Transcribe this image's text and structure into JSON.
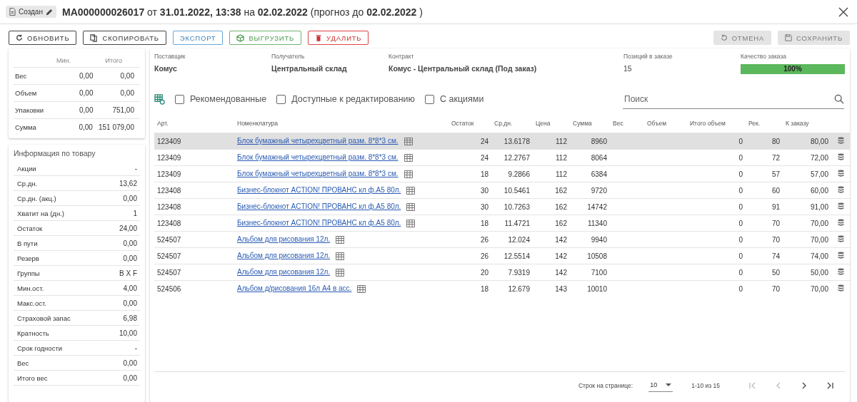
{
  "header": {
    "status": "Создан",
    "title": "**MA000000026017** от **31.01.2022, 13:38** на **02.02.2022** (прогноз до **02.02.2022** )"
  },
  "toolbar": [
    {
      "label": "ОБНОВИТЬ",
      "kind": "refresh",
      "disabled": false
    },
    {
      "label": "СКОПИРОВАТЬ",
      "kind": "copy",
      "disabled": false
    },
    {
      "label": "ЭКСПОРТ",
      "kind": "export",
      "disabled": false
    },
    {
      "label": "ВЫГРУЗИТЬ",
      "kind": "upload",
      "disabled": false
    },
    {
      "label": "УДАЛИТЬ",
      "kind": "delete",
      "disabled": false
    },
    {
      "label": "ОТМЕНА",
      "kind": "undo",
      "disabled": true
    },
    {
      "label": "СОХРАНИТЬ",
      "kind": "save",
      "disabled": true
    }
  ],
  "summary": {
    "columns": [
      "Мин.",
      "Итого"
    ],
    "rows": [
      {
        "label": "Вес",
        "min": "0,00",
        "total": "0,00"
      },
      {
        "label": "Объем",
        "min": "0,00",
        "total": "0,00"
      },
      {
        "label": "Упаковки",
        "min": "0,00",
        "total": "751,00"
      },
      {
        "label": "Сумма",
        "min": "0,00",
        "total": "151 079,00"
      }
    ]
  },
  "product_info": {
    "title": "Информация по товару",
    "rows": [
      {
        "label": "Акции",
        "value": "-"
      },
      {
        "label": "Ср.дн.",
        "value": "13,62"
      },
      {
        "label": "Ср.дн. (акц.)",
        "value": "0,00"
      },
      {
        "label": "Хватит на (дн.)",
        "value": "1"
      },
      {
        "label": "Остаток",
        "value": "24,00"
      },
      {
        "label": "В пути",
        "value": "0,00"
      },
      {
        "label": "Резерв",
        "value": "0,00"
      },
      {
        "label": "Группы",
        "value": "B X F"
      },
      {
        "label": "Мин.ост.",
        "value": "4,00"
      },
      {
        "label": "Макс.ост.",
        "value": "0,00"
      },
      {
        "label": "Страховой запас",
        "value": "6,98"
      },
      {
        "label": "Кратность",
        "value": "10,00"
      },
      {
        "label": "Срок годности",
        "value": "-"
      },
      {
        "label": "Вес",
        "value": "0,00"
      },
      {
        "label": "Итого вес",
        "value": "0,00"
      }
    ]
  },
  "order_info": [
    {
      "label": "Поставщик",
      "value": "Комус"
    },
    {
      "label": "Получатель",
      "value": "Центральный склад"
    },
    {
      "label": "Контракт",
      "value": "Комус - Центральный склад (Под заказ)"
    },
    {
      "label": "Позиций в заказе",
      "value": "15"
    }
  ],
  "quality": {
    "label": "Качество заказа",
    "level": 1.0,
    "text": "100%"
  },
  "filters": [
    {
      "label": "Рекомендованные",
      "checked": false
    },
    {
      "label": "Доступные к редактированию",
      "checked": false
    },
    {
      "label": "С акциями",
      "checked": false
    }
  ],
  "search": {
    "placeholder": "Поиск"
  },
  "table": {
    "columns": [
      "Арт.",
      "Номенклатура",
      "Остаток",
      "Ср.дн.",
      "Цена",
      "Сумма",
      "Вес",
      "Объем",
      "Итого объем",
      "Рек.",
      "К заказу"
    ],
    "rows": [
      {
        "selected": true,
        "art": "123409",
        "name": "Блок бумажный четырехцветный разм. 8*8*3 см.",
        "stock": "24",
        "avg": "13.6178",
        "price": "112",
        "sum": "8960",
        "total_volume": "0",
        "rec": "80",
        "order": "80,00"
      },
      {
        "selected": false,
        "art": "123409",
        "name": "Блок бумажный четырехцветный разм. 8*8*3 см.",
        "stock": "24",
        "avg": "12.2767",
        "price": "112",
        "sum": "8064",
        "total_volume": "0",
        "rec": "72",
        "order": "72,00"
      },
      {
        "selected": false,
        "art": "123409",
        "name": "Блок бумажный четырехцветный разм. 8*8*3 см.",
        "stock": "18",
        "avg": "9.2866",
        "price": "112",
        "sum": "6384",
        "total_volume": "0",
        "rec": "57",
        "order": "57,00"
      },
      {
        "selected": false,
        "art": "123408",
        "name": "Бизнес-блокнот ACTION! ПРОВАНС кл ф.А5 80л.",
        "stock": "30",
        "avg": "10.5461",
        "price": "162",
        "sum": "9720",
        "total_volume": "0",
        "rec": "60",
        "order": "60,00"
      },
      {
        "selected": false,
        "art": "123408",
        "name": "Бизнес-блокнот ACTION! ПРОВАНС кл ф.А5 80л.",
        "stock": "30",
        "avg": "10.7263",
        "price": "162",
        "sum": "14742",
        "total_volume": "0",
        "rec": "91",
        "order": "91,00"
      },
      {
        "selected": false,
        "art": "123408",
        "name": "Бизнес-блокнот ACTION! ПРОВАНС кл ф.А5 80л.",
        "stock": "18",
        "avg": "11.4721",
        "price": "162",
        "sum": "11340",
        "total_volume": "0",
        "rec": "70",
        "order": "70,00"
      },
      {
        "selected": false,
        "art": "524507",
        "name": "Альбом для рисования 12л.",
        "stock": "26",
        "avg": "12.024",
        "price": "142",
        "sum": "9940",
        "total_volume": "0",
        "rec": "70",
        "order": "70,00"
      },
      {
        "selected": false,
        "art": "524507",
        "name": "Альбом для рисования 12л.",
        "stock": "26",
        "avg": "12.5514",
        "price": "142",
        "sum": "10508",
        "total_volume": "0",
        "rec": "74",
        "order": "74,00"
      },
      {
        "selected": false,
        "art": "524507",
        "name": "Альбом для рисования 12л.",
        "stock": "20",
        "avg": "7.9319",
        "price": "142",
        "sum": "7100",
        "total_volume": "0",
        "rec": "50",
        "order": "50,00"
      },
      {
        "selected": false,
        "art": "524506",
        "name": "Альбом д/рисования 16л А4 в асс.",
        "stock": "18",
        "avg": "12.679",
        "price": "143",
        "sum": "10010",
        "total_volume": "0",
        "rec": "70",
        "order": "70,00"
      }
    ]
  },
  "pagination": {
    "rows_label": "Строк на странице:",
    "rows_per_page": "10",
    "range": "1-10 из 15",
    "nav": [
      {
        "kind": "first",
        "disabled": true
      },
      {
        "kind": "prev",
        "disabled": true
      },
      {
        "kind": "next",
        "disabled": false
      },
      {
        "kind": "last",
        "disabled": false
      }
    ]
  }
}
